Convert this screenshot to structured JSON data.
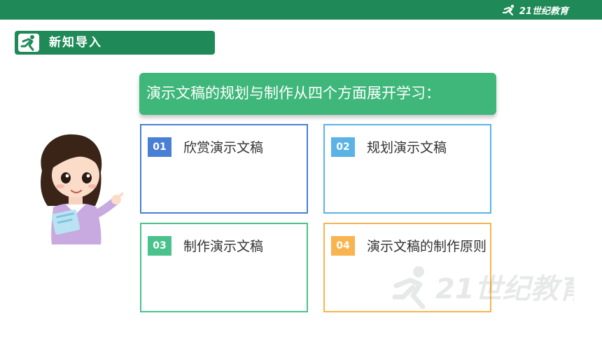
{
  "header": {
    "brand_logo_text": "21世纪教育",
    "colors": {
      "bar": "#1f8a57"
    }
  },
  "section": {
    "title": "新知导入",
    "icon": "running-person-icon"
  },
  "banner": {
    "text": "演示文稿的规划与制作从四个方面展开学习：",
    "color": "#3fb77a"
  },
  "cards": [
    {
      "num": "01",
      "label": "欣赏演示文稿",
      "color": "#4a7fd6"
    },
    {
      "num": "02",
      "label": "规划演示文稿",
      "color": "#5ab3e4"
    },
    {
      "num": "03",
      "label": "制作演示文稿",
      "color": "#49c28c"
    },
    {
      "num": "04",
      "label": "演示文稿的制作原则",
      "color": "#f7b450"
    }
  ],
  "illustration": "girl-teacher-pointing",
  "watermark": "21世纪教育"
}
